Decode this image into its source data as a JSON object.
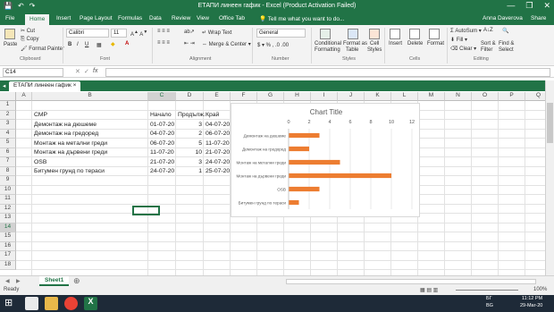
{
  "window": {
    "title": "ЕТАПИ  линеен гафик - Excel (Product Activation Failed)",
    "minimize": "—",
    "restore": "❐",
    "close": "✕"
  },
  "quick_access": {
    "save": "💾",
    "undo": "↶",
    "redo": "↷"
  },
  "ribbon_tabs": [
    "File",
    "Home",
    "Insert",
    "Page Layout",
    "Formulas",
    "Data",
    "Review",
    "View",
    "Office Tab"
  ],
  "tell_me": "Tell me what you want to do...",
  "user": "Anna Daverova",
  "share": "Share",
  "ribbon": {
    "paste": "Paste",
    "cut": "Cut",
    "copy": "Copy",
    "format_painter": "Format Painter",
    "font_name": "Calibri",
    "font_size": "11",
    "bold": "B",
    "italic": "I",
    "underline": "U",
    "wrap_text": "Wrap Text",
    "merge_center": "Merge & Center",
    "number_format": "General",
    "conditional": "Conditional",
    "formatting": "Formatting",
    "format_as": "Format as",
    "table": "Table",
    "cell": "Cell",
    "styles": "Styles",
    "insert": "Insert",
    "delete": "Delete",
    "format": "Format",
    "autosum": "AutoSum",
    "fill": "Fill",
    "clear": "Clear",
    "sort": "Sort &",
    "filter": "Filter",
    "find": "Find &",
    "select": "Select",
    "groups": {
      "clipboard": "Clipboard",
      "font": "Font",
      "alignment": "Alignment",
      "number": "Number",
      "styles": "Styles",
      "cells": "Cells",
      "editing": "Editing"
    }
  },
  "formula_bar": {
    "name_box": "C14",
    "fx": "fx",
    "cancel": "✕",
    "enter": "✓",
    "value": ""
  },
  "doc_tab": "ЕТАПИ  линеен гафик",
  "columns": [
    "A",
    "B",
    "C",
    "D",
    "E",
    "F",
    "G",
    "H",
    "I",
    "J",
    "K",
    "L",
    "M",
    "N",
    "O",
    "P",
    "Q"
  ],
  "rows": [
    "1",
    "2",
    "3",
    "4",
    "5",
    "6",
    "7",
    "8",
    "9",
    "10",
    "11",
    "12",
    "13",
    "14",
    "15",
    "16",
    "17",
    "18"
  ],
  "table": {
    "headers": {
      "b": "СМР",
      "c": "Начало",
      "d": "Продълж.",
      "e": "Край"
    },
    "rows": [
      {
        "b": "Демонтаж на дюшеме",
        "c": "01-07-20",
        "d": "3",
        "e": "04-07-20"
      },
      {
        "b": "Демонтаж на гредоред",
        "c": "04-07-20",
        "d": "2",
        "e": "06-07-20"
      },
      {
        "b": "Монтаж на метални греди",
        "c": "06-07-20",
        "d": "5",
        "e": "11-07-20"
      },
      {
        "b": "Монтаж на дървени греди",
        "c": "11-07-20",
        "d": "10",
        "e": "21-07-20"
      },
      {
        "b": "OSB",
        "c": "21-07-20",
        "d": "3",
        "e": "24-07-20"
      },
      {
        "b": "Битумен грунд по тераси",
        "c": "24-07-20",
        "d": "1",
        "e": "25-07-20"
      }
    ]
  },
  "chart_data": {
    "type": "bar",
    "orientation": "horizontal",
    "title": "Chart Title",
    "categories": [
      "Демонтаж на дюшеме",
      "Демонтаж на гредоред",
      "Монтаж на метални греди",
      "Монтаж на дървени греди",
      "OSB",
      "Битумен грунд по тераси"
    ],
    "values": [
      3,
      2,
      5,
      10,
      3,
      1
    ],
    "xlim": [
      0,
      12
    ],
    "ticks": [
      "0",
      "2",
      "4",
      "6",
      "8",
      "10",
      "12"
    ],
    "grid": true,
    "bar_color": "#ed7d31"
  },
  "sheet_tabs": [
    "Sheet1"
  ],
  "status": {
    "ready": "Ready",
    "zoom": "100%"
  },
  "taskbar": {
    "lang": "БГ",
    "lang2": "BG",
    "time": "11:12 PM",
    "date": "29-Mar-20"
  }
}
